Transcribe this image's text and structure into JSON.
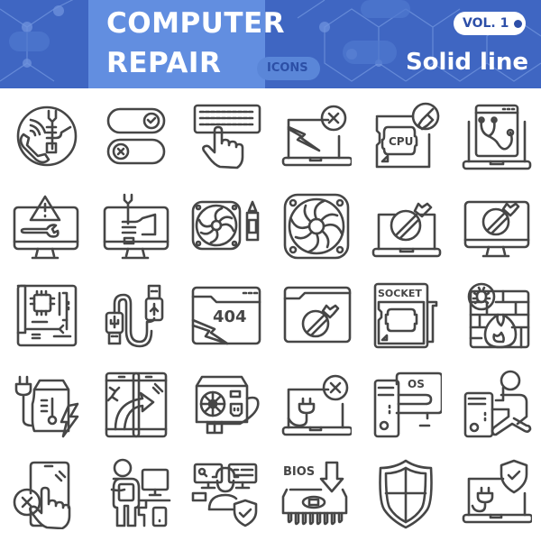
{
  "header": {
    "title_line1": "COMPUTER",
    "title_line2": "REPAIR",
    "icons_label": "ICONS",
    "volume_badge": "VOL. 1",
    "style_label": "Solid line",
    "colors": {
      "background": "#3f66c2",
      "title_panel": "#628ee0",
      "badge_text": "#2d4fa8",
      "icon_stroke": "#464646"
    }
  },
  "icons": {
    "cpu_text": "CPU",
    "error_text": "404",
    "socket_text": "SOCKET",
    "os_text": "OS",
    "bios_text": "BIOS",
    "rows": [
      [
        "phone-repair-support-icon",
        "toggle-switches-icon",
        "keyboard-touch-icon",
        "laptop-broken-error-icon",
        "cpu-repair-icon",
        "laptop-diagnostics-icon"
      ],
      [
        "monitor-warning-repair-icon",
        "monitor-hand-wrench-icon",
        "fan-and-lubricant-icon",
        "cooling-fan-icon",
        "laptop-repair-icon",
        "monitor-repair-icon"
      ],
      [
        "motherboard-icon",
        "usb-cable-icon",
        "browser-404-error-icon",
        "browser-repair-icon",
        "cpu-socket-icon",
        "firewall-virus-icon"
      ],
      [
        "power-supply-overheat-icon",
        "phone-screen-replacement-icon",
        "power-supply-unit-icon",
        "laptop-power-error-icon",
        "pc-os-install-icon",
        "technician-with-pc-icon"
      ],
      [
        "phone-touch-error-icon",
        "technician-at-workstation-icon",
        "remote-support-engineer-icon",
        "bios-update-icon",
        "security-shield-icon",
        "laptop-power-protected-icon"
      ]
    ]
  }
}
